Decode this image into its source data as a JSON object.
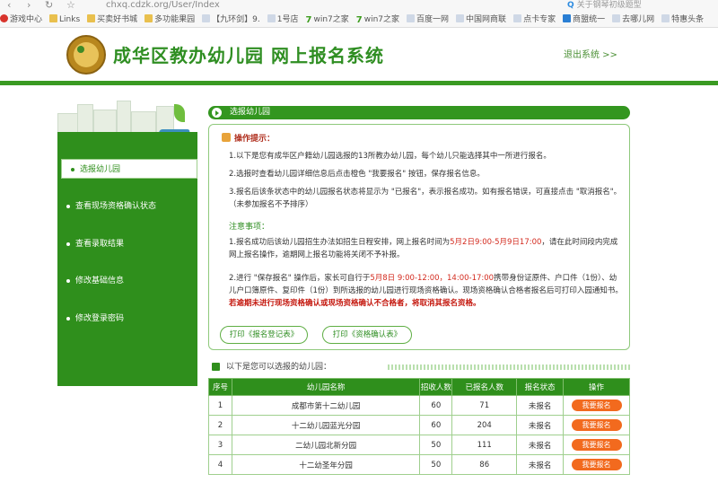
{
  "browser": {
    "nav": [
      "‹",
      "›",
      "↻",
      "☆"
    ],
    "url": "chxq.cdzk.org/User/Index",
    "search_placeholder": "关于钢琴初级题型",
    "bookmarks": [
      {
        "label": "游戏中心",
        "icon": "red"
      },
      {
        "label": "Links",
        "icon": "folder"
      },
      {
        "label": "买卖好书城",
        "icon": "folder"
      },
      {
        "label": "多功能果园",
        "icon": "folder"
      },
      {
        "label": "【九环剑】9.",
        "icon": "page"
      },
      {
        "label": "1号店",
        "icon": "page"
      },
      {
        "label": "win7之家",
        "icon": "green7"
      },
      {
        "label": "win7之家",
        "icon": "green7"
      },
      {
        "label": "百度一网",
        "icon": "page"
      },
      {
        "label": "中国网商联",
        "icon": "page"
      },
      {
        "label": "点卡专家",
        "icon": "page"
      },
      {
        "label": "商盟统一",
        "icon": "blue"
      },
      {
        "label": "去哪儿网",
        "icon": "page"
      },
      {
        "label": "特惠头条",
        "icon": "page"
      }
    ]
  },
  "header": {
    "title": "成华区教办幼儿园  网上报名系统",
    "logout": "退出系统 >>"
  },
  "sidebar": {
    "items": [
      {
        "label": "选报幼儿园",
        "active": true
      },
      {
        "label": "查看现场资格确认状态",
        "active": false
      },
      {
        "label": "查看录取结果",
        "active": false
      },
      {
        "label": "修改基础信息",
        "active": false
      },
      {
        "label": "修改登录密码",
        "active": false
      }
    ]
  },
  "main": {
    "section_title": "选报幼儿园",
    "notice": {
      "heading": "操作提示：",
      "p1": "1.以下是您有成华区户籍幼儿园选报的13所教办幼儿园，每个幼儿只能选择其中一所进行报名。",
      "p2": "2.选报时查看幼儿园详细信息后点击橙色 \"我要报名\" 按钮，保存报名信息。",
      "p3": "3.报名后该条状态中的幼儿园报名状态将显示为 \"已报名\"，表示报名成功。如有报名错误，可直接点击 \"取消报名\"。（未参加报名不予排序）",
      "sub_heading": "注意事项：",
      "p4_a": "1.报名成功后该幼儿园招生办法如招生日程安排，网上报名时间为",
      "p4_red": "5月2日9:00-5月9日17:00",
      "p4_b": "，请在此时间段内完成网上报名操作，逾期网上报名功能将关闭不予补报。",
      "p5_a": "2.进行 \"保存报名\" 操作后，家长可自行于",
      "p5_red": "5月8日 9:00-12:00，14:00-17:00",
      "p5_b": "携带身份证原件、户口件（1份）、幼儿户口簿原件、复印件（1份）到所选报的幼儿园进行现场资格确认。现场资格确认合格者报名后可打印入园通知书。",
      "p5_warn": "若逾期未进行现场资格确认或现场资格确认不合格者，将取消其报名资格。"
    },
    "print_buttons": [
      "打印《报名登记表》",
      "打印《资格确认表》"
    ],
    "list_heading": "以下是您可以选报的幼儿园：",
    "table": {
      "headers": [
        "序号",
        "幼儿园名称",
        "招收人数",
        "已报名人数",
        "报名状态",
        "操作"
      ],
      "rows": [
        {
          "no": "1",
          "name": "成都市第十二幼儿园",
          "quota": "60",
          "applied": "71",
          "status": "未报名",
          "action": "我要报名"
        },
        {
          "no": "2",
          "name": "十二幼儿园蓝光分园",
          "quota": "60",
          "applied": "204",
          "status": "未报名",
          "action": "我要报名"
        },
        {
          "no": "3",
          "name": "二幼儿园北新分园",
          "quota": "50",
          "applied": "111",
          "status": "未报名",
          "action": "我要报名"
        },
        {
          "no": "4",
          "name": "十二幼圣年分园",
          "quota": "50",
          "applied": "86",
          "status": "未报名",
          "action": "我要报名"
        }
      ]
    }
  },
  "colors": {
    "brand_green": "#2f8f1c",
    "accent_orange": "#f26a1e",
    "warning_red": "#d32a1e"
  }
}
